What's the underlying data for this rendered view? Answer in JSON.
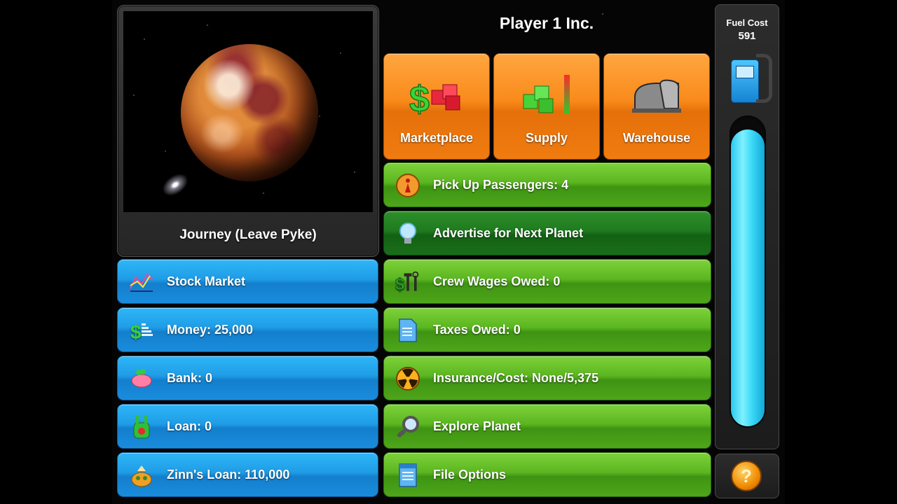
{
  "company": {
    "name": "Player 1 Inc."
  },
  "planet_panel": {
    "journey_label": "Journey (Leave Pyke)"
  },
  "left_buttons": [
    {
      "label": "Stock Market",
      "icon": "chart-icon"
    },
    {
      "label": "Money: 25,000",
      "icon": "money-icon"
    },
    {
      "label": "Bank: 0",
      "icon": "piggy-bank-icon"
    },
    {
      "label": "Loan: 0",
      "icon": "loan-creature-icon"
    },
    {
      "label": "Zinn's Loan: 110,000",
      "icon": "zinn-icon"
    }
  ],
  "tiles": [
    {
      "label": "Marketplace",
      "icon": "marketplace-icon"
    },
    {
      "label": "Supply",
      "icon": "supply-icon"
    },
    {
      "label": "Warehouse",
      "icon": "warehouse-icon"
    }
  ],
  "right_buttons": [
    {
      "label": "Pick Up Passengers: 4",
      "icon": "passenger-icon"
    },
    {
      "label": "Advertise for Next Planet",
      "icon": "lightbulb-icon"
    },
    {
      "label": "Crew Wages Owed: 0",
      "icon": "tools-icon"
    },
    {
      "label": "Taxes Owed: 0",
      "icon": "document-icon"
    },
    {
      "label": "Insurance/Cost: None/5,375",
      "icon": "radiation-icon"
    },
    {
      "label": "Explore Planet",
      "icon": "magnifier-icon"
    },
    {
      "label": "File Options",
      "icon": "file-icon"
    }
  ],
  "fuel": {
    "title": "Fuel Cost",
    "value": "591",
    "level": 0.96
  },
  "help": {
    "glyph": "?"
  },
  "colors": {
    "blue_button": "#1f9ce6",
    "green_button": "#5bb620",
    "orange_tile": "#f98a1a",
    "fuel": "#3fdcf8"
  }
}
